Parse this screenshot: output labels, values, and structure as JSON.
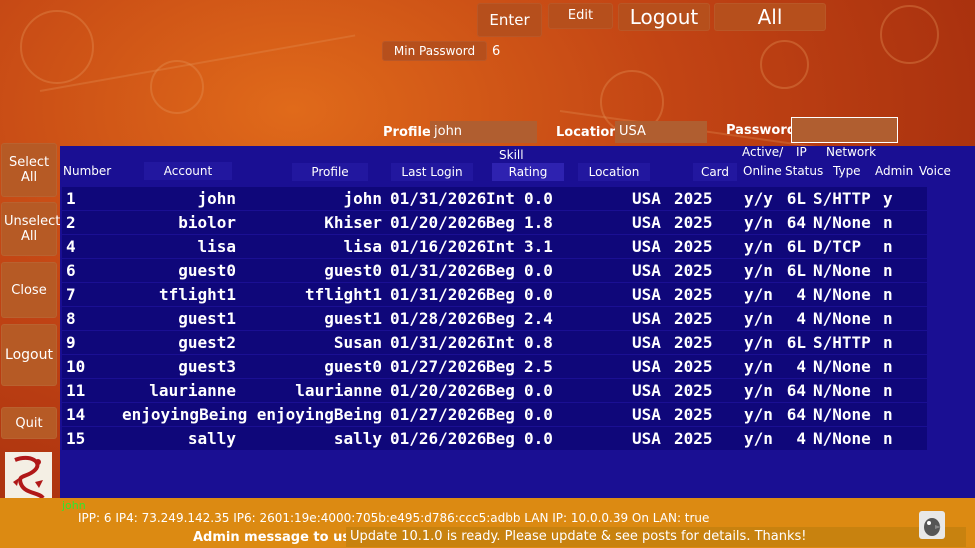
{
  "top_buttons": {
    "enter": "Enter",
    "edit": "Edit",
    "logout": "Logout",
    "all": "All",
    "min_password": "Min Password",
    "min_password_value": "6"
  },
  "filters": {
    "profile_label": "Profile:",
    "profile_value": "john",
    "location_label": "Location:",
    "location_value": "USA",
    "password_label": "Password:",
    "password_value": ""
  },
  "sidebar": {
    "select_all": "Select All",
    "unselect_all": "Unselect All",
    "close": "Close",
    "logout": "Logout",
    "quit": "Quit"
  },
  "table": {
    "headers": {
      "number": "Number",
      "account": "Account",
      "profile": "Profile",
      "last_login": "Last Login",
      "skill": "Skill",
      "rating": "Rating",
      "location": "Location",
      "card": "Card",
      "active": "Active/",
      "online": "Online",
      "ip": "IP",
      "status": "Status",
      "network": "Network",
      "type": "Type",
      "admin": "Admin",
      "voice": "Voice"
    },
    "rows": [
      {
        "number": "1",
        "account": "john",
        "profile": "john",
        "last_login": "01/31/2026",
        "skill": "Int",
        "rating": "0.0",
        "location": "USA",
        "card": "2025",
        "online": "y/y",
        "ip": "6L",
        "network": "S/HTTP",
        "admin": "y"
      },
      {
        "number": "2",
        "account": "biolor",
        "profile": "Khiser",
        "last_login": "01/20/2026",
        "skill": "Beg",
        "rating": "1.8",
        "location": "USA",
        "card": "2025",
        "online": "y/n",
        "ip": "64",
        "network": "N/None",
        "admin": "n"
      },
      {
        "number": "4",
        "account": "lisa",
        "profile": "lisa",
        "last_login": "01/16/2026",
        "skill": "Int",
        "rating": "3.1",
        "location": "USA",
        "card": "2025",
        "online": "y/n",
        "ip": "6L",
        "network": "D/TCP",
        "admin": "n"
      },
      {
        "number": "6",
        "account": "guest0",
        "profile": "guest0",
        "last_login": "01/31/2026",
        "skill": "Beg",
        "rating": "0.0",
        "location": "USA",
        "card": "2025",
        "online": "y/n",
        "ip": "6L",
        "network": "N/None",
        "admin": "n"
      },
      {
        "number": "7",
        "account": "tflight1",
        "profile": "tflight1",
        "last_login": "01/31/2026",
        "skill": "Beg",
        "rating": "0.0",
        "location": "USA",
        "card": "2025",
        "online": "y/n",
        "ip": "4",
        "network": "N/None",
        "admin": "n"
      },
      {
        "number": "8",
        "account": "guest1",
        "profile": "guest1",
        "last_login": "01/28/2026",
        "skill": "Beg",
        "rating": "2.4",
        "location": "USA",
        "card": "2025",
        "online": "y/n",
        "ip": "4",
        "network": "N/None",
        "admin": "n"
      },
      {
        "number": "9",
        "account": "guest2",
        "profile": "Susan",
        "last_login": "01/31/2026",
        "skill": "Int",
        "rating": "0.8",
        "location": "USA",
        "card": "2025",
        "online": "y/n",
        "ip": "6L",
        "network": "S/HTTP",
        "admin": "n"
      },
      {
        "number": "10",
        "account": "guest3",
        "profile": "guest0",
        "last_login": "01/27/2026",
        "skill": "Beg",
        "rating": "2.5",
        "location": "USA",
        "card": "2025",
        "online": "y/n",
        "ip": "4",
        "network": "N/None",
        "admin": "n"
      },
      {
        "number": "11",
        "account": "laurianne",
        "profile": "laurianne",
        "last_login": "01/20/2026",
        "skill": "Beg",
        "rating": "0.0",
        "location": "USA",
        "card": "2025",
        "online": "y/n",
        "ip": "64",
        "network": "N/None",
        "admin": "n"
      },
      {
        "number": "14",
        "account": "enjoyingBeing",
        "profile": "enjoyingBeing",
        "last_login": "01/27/2026",
        "skill": "Beg",
        "rating": "0.0",
        "location": "USA",
        "card": "2025",
        "online": "y/n",
        "ip": "64",
        "network": "N/None",
        "admin": "n"
      },
      {
        "number": "15",
        "account": "sally",
        "profile": "sally",
        "last_login": "01/26/2026",
        "skill": "Beg",
        "rating": "0.0",
        "location": "USA",
        "card": "2025",
        "online": "y/n",
        "ip": "4",
        "network": "N/None",
        "admin": "n"
      }
    ]
  },
  "status": {
    "current_user": "john",
    "network_info": "IPP: 6  IP4: 73.249.142.35  IP6: 2601:19e:4000:705b:e495:d786:ccc5:adbb  LAN IP: 10.0.0.39  On LAN: true",
    "admin_label": "Admin message to users:",
    "admin_message": "Update 10.1.0 is ready. Please update & see posts for details. Thanks!"
  },
  "icons": {
    "logo": "dragon-logo-icon",
    "avatar": "bird-avatar-icon"
  },
  "colors": {
    "background": "#c24414",
    "panel": "#1a0f93",
    "row": "#0f077a",
    "button": "#b8561e",
    "statusbar": "#dc8a12",
    "current_user": "#2ee82e"
  }
}
